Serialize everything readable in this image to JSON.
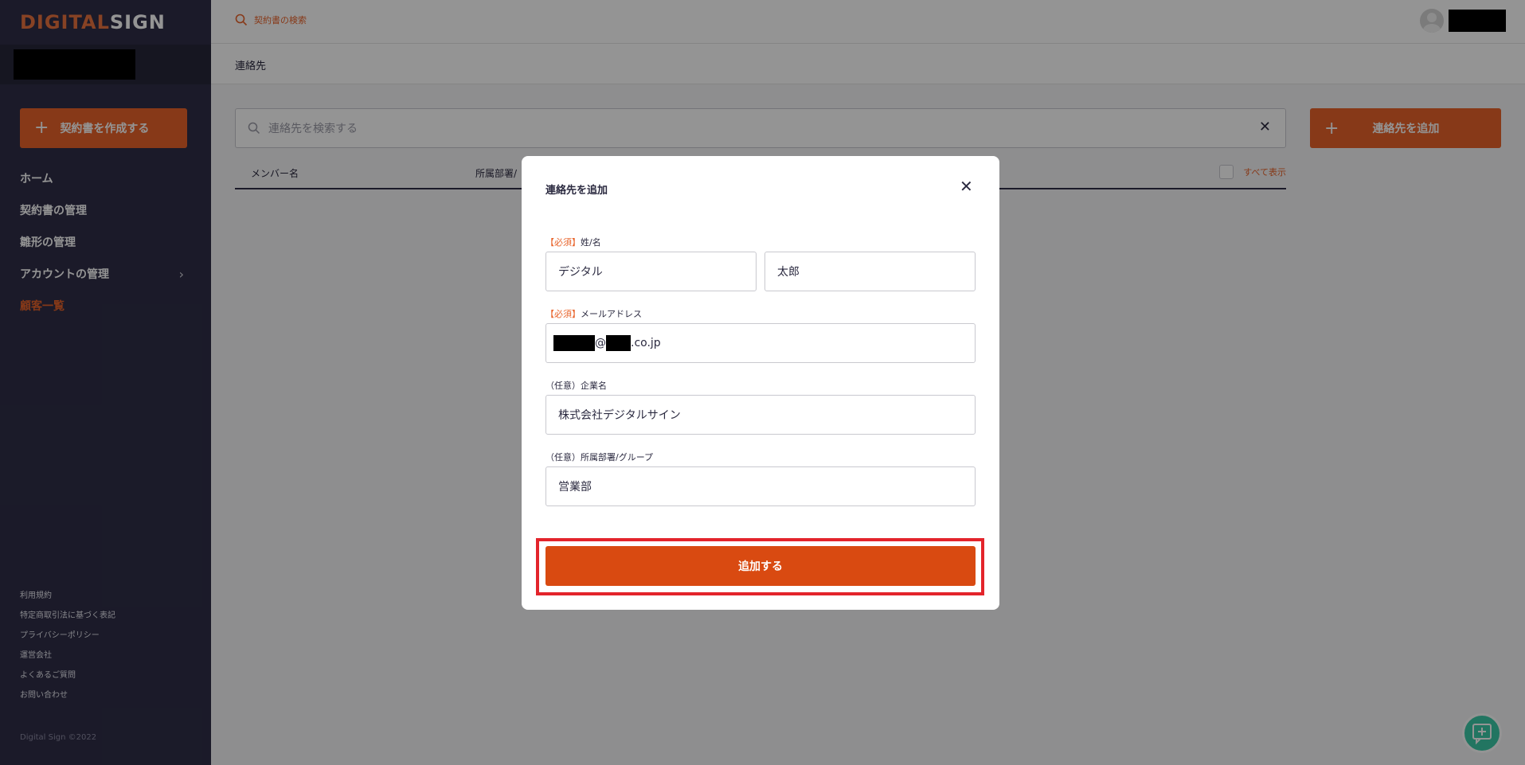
{
  "app": {
    "logo_part1": "DIGITAL",
    "logo_part2": "SIGN"
  },
  "sidebar": {
    "create_button": "契約書を作成する",
    "items": [
      {
        "label": "ホーム",
        "active": false
      },
      {
        "label": "契約書の管理",
        "active": false
      },
      {
        "label": "雛形の管理",
        "active": false
      },
      {
        "label": "アカウントの管理",
        "active": false,
        "has_chevron": true
      },
      {
        "label": "顧客一覧",
        "active": true
      }
    ],
    "footer_links": [
      "利用規約",
      "特定商取引法に基づく表記",
      "プライバシーポリシー",
      "運営会社",
      "よくあるご質問",
      "お問い合わせ"
    ],
    "copyright": "Digital Sign ©2022"
  },
  "header": {
    "search_label": "契約書の検索"
  },
  "page": {
    "breadcrumb": "連絡先",
    "search_placeholder": "連絡先を検索する",
    "add_contact_button": "連絡先を追加",
    "columns": [
      "メンバー名",
      "所属部署/"
    ],
    "show_all_label": "すべて表示"
  },
  "modal": {
    "title": "連絡先を追加",
    "name_label_required": "【必須】",
    "name_label": "姓/名",
    "last_name_value": "デジタル",
    "first_name_value": "太郎",
    "email_label_required": "【必須】",
    "email_label": "メールアドレス",
    "email_at": "@",
    "email_domain_suffix": ".co.jp",
    "company_label_optional": "（任意）",
    "company_label": "企業名",
    "company_value": "株式会社デジタルサイン",
    "dept_label_optional": "（任意）",
    "dept_label": "所属部署/グループ",
    "dept_value": "営業部",
    "submit_button": "追加する"
  },
  "colors": {
    "accent": "#e8632a",
    "sidebar_bg": "#2f2e47",
    "highlight_frame": "#e3242b",
    "chat_fab": "#3ccaa8"
  }
}
